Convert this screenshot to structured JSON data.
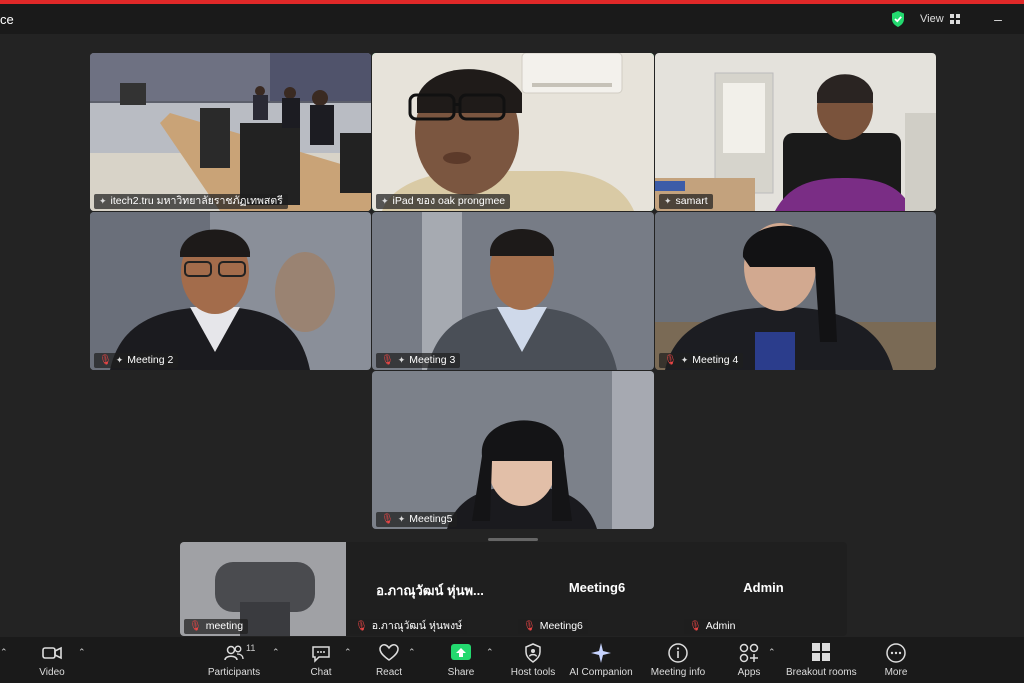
{
  "window": {
    "title_fragment": "ce",
    "view_label": "View"
  },
  "tiles": [
    {
      "name": "itech2.tru มหาวิทยาลัยราชภัฏเทพสตรี",
      "muted": false
    },
    {
      "name": "iPad ของ oak prongmee",
      "muted": false,
      "speaking": true
    },
    {
      "name": "samart",
      "muted": false
    },
    {
      "name": "Meeting 2",
      "muted": true
    },
    {
      "name": "Meeting 3",
      "muted": true
    },
    {
      "name": "Meeting 4",
      "muted": true
    },
    {
      "name": "Meeting5",
      "muted": true
    }
  ],
  "strip": [
    {
      "display": "",
      "name": "meeting",
      "muted": true
    },
    {
      "display": "อ.ภาณุวัฒน์ หุ่นพ...",
      "name": "อ.ภาณุวัฒน์ หุ่นพงษ์",
      "muted": true
    },
    {
      "display": "Meeting6",
      "name": "Meeting6",
      "muted": true
    },
    {
      "display": "Admin",
      "name": "Admin",
      "muted": true
    }
  ],
  "toolbar": {
    "video": "Video",
    "participants": "Participants",
    "participants_count": "11",
    "chat": "Chat",
    "react": "React",
    "share": "Share",
    "host_tools": "Host tools",
    "ai_companion": "AI Companion",
    "meeting_info": "Meeting info",
    "apps": "Apps",
    "breakout_rooms": "Breakout rooms",
    "more": "More"
  },
  "colors": {
    "speaker_border": "#23d96f",
    "share_green": "#23d96f",
    "mute_red": "#e84545",
    "top_bar": "#e02828"
  }
}
